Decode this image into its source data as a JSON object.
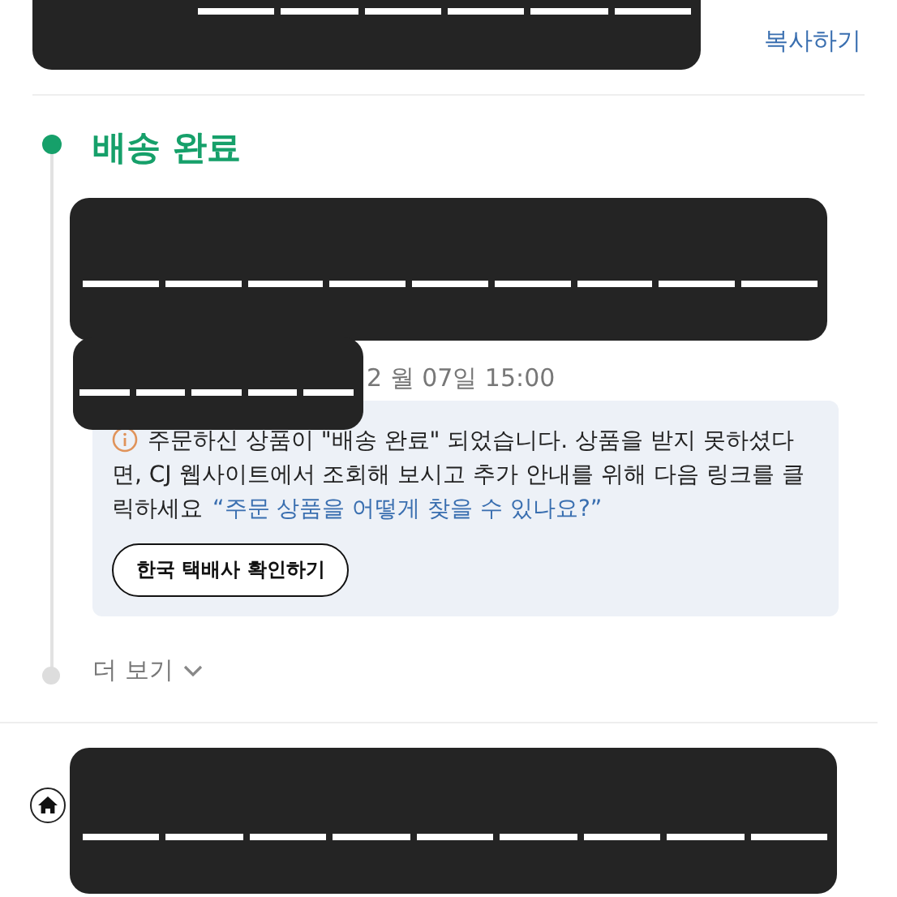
{
  "copy_link": "복사하기",
  "status": {
    "title": "배송 완료",
    "done": true
  },
  "timestamp": "2 월 07일 15:00",
  "notice": {
    "text": "주문하신 상품이 \"배송 완료\" 되었습니다. 상품을 받지 못하셨다면, CJ 웹사이트에서 조회해 보시고 추가 안내를 위해 다음 링크를 클릭하세요",
    "link": "“주문 상품을 어떻게 찾을 수 있나요?”",
    "button": "한국 택배사 확인하기"
  },
  "more": "더 보기"
}
